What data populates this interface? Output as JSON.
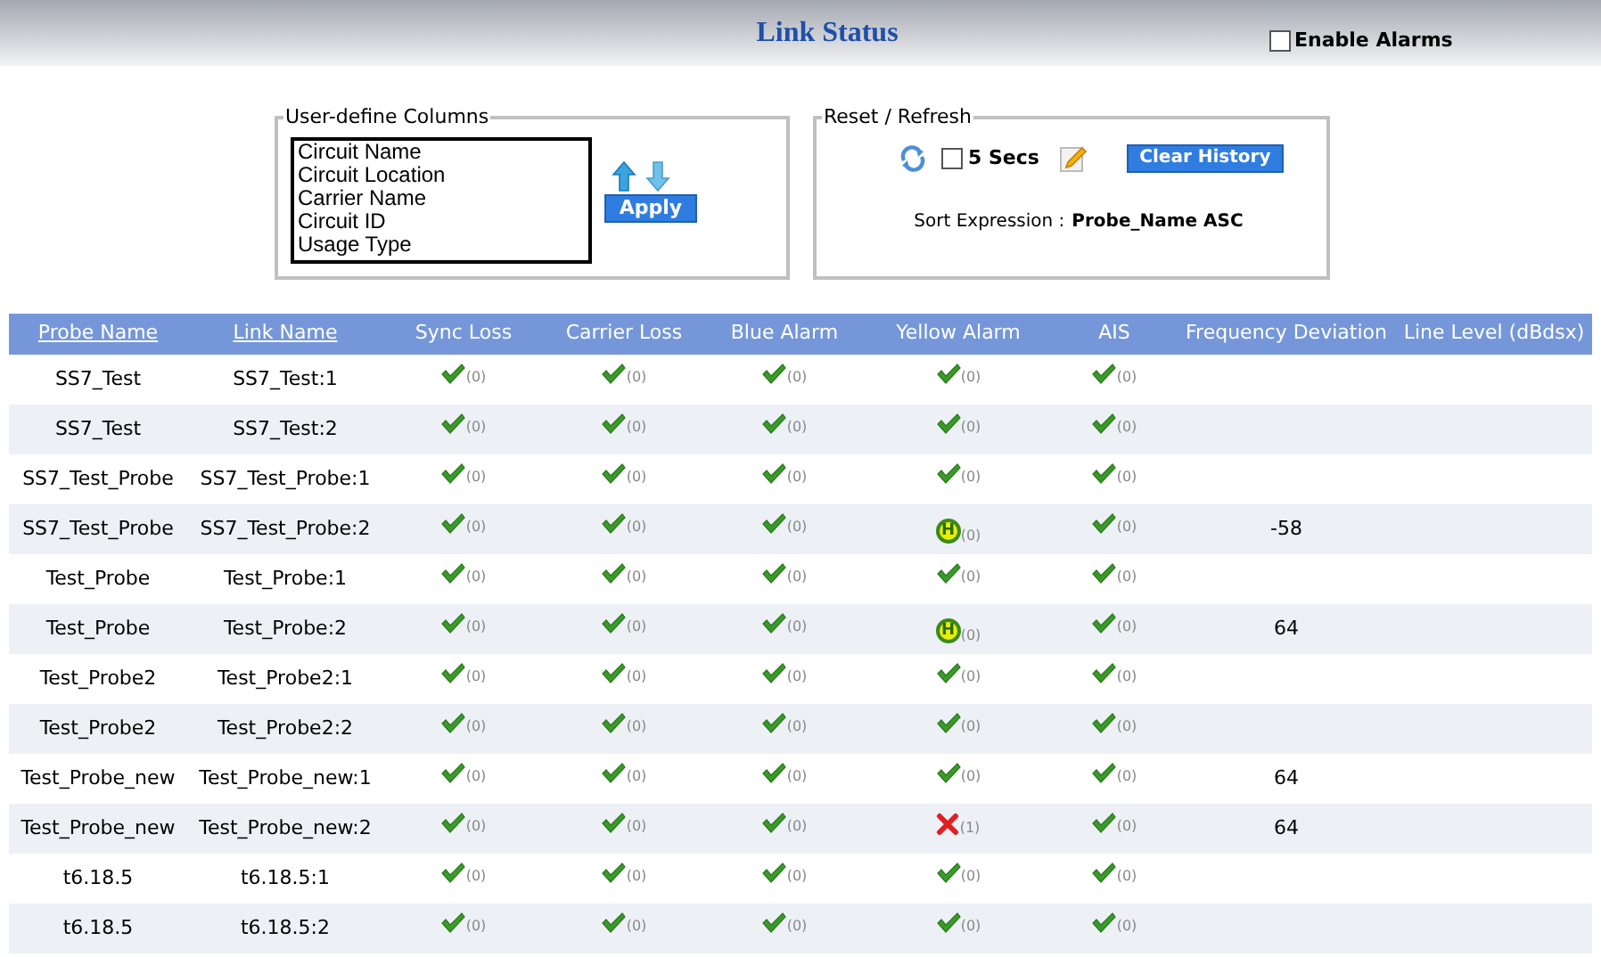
{
  "header": {
    "title": "Link Status",
    "enable_alarms": {
      "label": "Enable Alarms",
      "checked": false
    }
  },
  "columns_panel": {
    "legend": "User-define Columns",
    "items": [
      "Circuit Name",
      "Circuit Location",
      "Carrier Name",
      "Circuit ID",
      "Usage Type"
    ],
    "apply_button": "Apply"
  },
  "refresh_panel": {
    "legend": "Reset / Refresh",
    "auto_refresh": {
      "label": "5 Secs",
      "checked": false
    },
    "clear_button": "Clear History",
    "sort_label": "Sort Expression :",
    "sort_value": "Probe_Name ASC"
  },
  "table": {
    "columns": [
      {
        "label": "Probe Name",
        "link": true
      },
      {
        "label": "Link Name",
        "link": true
      },
      {
        "label": "Sync Loss",
        "link": false
      },
      {
        "label": "Carrier Loss",
        "link": false
      },
      {
        "label": "Blue Alarm",
        "link": false
      },
      {
        "label": "Yellow Alarm",
        "link": false
      },
      {
        "label": "AIS",
        "link": false
      },
      {
        "label": "Frequency Deviation",
        "link": false
      },
      {
        "label": "Line Level (dBdsx)",
        "link": false
      }
    ],
    "rows": [
      {
        "probe": "SS7_Test",
        "link": "SS7_Test:1",
        "status": [
          {
            "kind": "ok",
            "count": "(0)"
          },
          {
            "kind": "ok",
            "count": "(0)"
          },
          {
            "kind": "ok",
            "count": "(0)"
          },
          {
            "kind": "ok",
            "count": "(0)"
          },
          {
            "kind": "ok",
            "count": "(0)"
          }
        ]
      },
      {
        "probe": "SS7_Test",
        "link": "SS7_Test:2",
        "status": [
          {
            "kind": "ok",
            "count": "(0)"
          },
          {
            "kind": "ok",
            "count": "(0)"
          },
          {
            "kind": "ok",
            "count": "(0)"
          },
          {
            "kind": "ok",
            "count": "(0)"
          },
          {
            "kind": "ok",
            "count": "(0)"
          }
        ]
      },
      {
        "probe": "SS7_Test_Probe",
        "link": "SS7_Test_Probe:1",
        "status": [
          {
            "kind": "ok",
            "count": "(0)"
          },
          {
            "kind": "ok",
            "count": "(0)"
          },
          {
            "kind": "ok",
            "count": "(0)"
          },
          {
            "kind": "ok",
            "count": "(0)"
          },
          {
            "kind": "ok",
            "count": "(0)"
          }
        ]
      },
      {
        "probe": "SS7_Test_Probe",
        "link": "SS7_Test_Probe:2",
        "status": [
          {
            "kind": "ok",
            "count": "(0)"
          },
          {
            "kind": "ok",
            "count": "(0)"
          },
          {
            "kind": "ok",
            "count": "(0)"
          },
          {
            "kind": "history",
            "count": "(0)",
            "badge": "H"
          },
          {
            "kind": "ok",
            "count": "(0)"
          }
        ],
        "frequency_deviation": "-58"
      },
      {
        "probe": "Test_Probe",
        "link": "Test_Probe:1",
        "status": [
          {
            "kind": "ok",
            "count": "(0)"
          },
          {
            "kind": "ok",
            "count": "(0)"
          },
          {
            "kind": "ok",
            "count": "(0)"
          },
          {
            "kind": "ok",
            "count": "(0)"
          },
          {
            "kind": "ok",
            "count": "(0)"
          }
        ]
      },
      {
        "probe": "Test_Probe",
        "link": "Test_Probe:2",
        "status": [
          {
            "kind": "ok",
            "count": "(0)"
          },
          {
            "kind": "ok",
            "count": "(0)"
          },
          {
            "kind": "ok",
            "count": "(0)"
          },
          {
            "kind": "history",
            "count": "(0)",
            "badge": "H"
          },
          {
            "kind": "ok",
            "count": "(0)"
          }
        ],
        "frequency_deviation": "64"
      },
      {
        "probe": "Test_Probe2",
        "link": "Test_Probe2:1",
        "status": [
          {
            "kind": "ok",
            "count": "(0)"
          },
          {
            "kind": "ok",
            "count": "(0)"
          },
          {
            "kind": "ok",
            "count": "(0)"
          },
          {
            "kind": "ok",
            "count": "(0)"
          },
          {
            "kind": "ok",
            "count": "(0)"
          }
        ]
      },
      {
        "probe": "Test_Probe2",
        "link": "Test_Probe2:2",
        "status": [
          {
            "kind": "ok",
            "count": "(0)"
          },
          {
            "kind": "ok",
            "count": "(0)"
          },
          {
            "kind": "ok",
            "count": "(0)"
          },
          {
            "kind": "ok",
            "count": "(0)"
          },
          {
            "kind": "ok",
            "count": "(0)"
          }
        ]
      },
      {
        "probe": "Test_Probe_new",
        "link": "Test_Probe_new:1",
        "status": [
          {
            "kind": "ok",
            "count": "(0)"
          },
          {
            "kind": "ok",
            "count": "(0)"
          },
          {
            "kind": "ok",
            "count": "(0)"
          },
          {
            "kind": "ok",
            "count": "(0)"
          },
          {
            "kind": "ok",
            "count": "(0)"
          }
        ],
        "frequency_deviation": "64"
      },
      {
        "probe": "Test_Probe_new",
        "link": "Test_Probe_new:2",
        "status": [
          {
            "kind": "ok",
            "count": "(0)"
          },
          {
            "kind": "ok",
            "count": "(0)"
          },
          {
            "kind": "ok",
            "count": "(0)"
          },
          {
            "kind": "fail",
            "count": "(1)"
          },
          {
            "kind": "ok",
            "count": "(0)"
          }
        ],
        "frequency_deviation": "64"
      },
      {
        "probe": "t6.18.5",
        "link": "t6.18.5:1",
        "status": [
          {
            "kind": "ok",
            "count": "(0)"
          },
          {
            "kind": "ok",
            "count": "(0)"
          },
          {
            "kind": "ok",
            "count": "(0)"
          },
          {
            "kind": "ok",
            "count": "(0)"
          },
          {
            "kind": "ok",
            "count": "(0)"
          }
        ]
      },
      {
        "probe": "t6.18.5",
        "link": "t6.18.5:2",
        "status": [
          {
            "kind": "ok",
            "count": "(0)"
          },
          {
            "kind": "ok",
            "count": "(0)"
          },
          {
            "kind": "ok",
            "count": "(0)"
          },
          {
            "kind": "ok",
            "count": "(0)"
          },
          {
            "kind": "ok",
            "count": "(0)"
          }
        ]
      }
    ]
  }
}
